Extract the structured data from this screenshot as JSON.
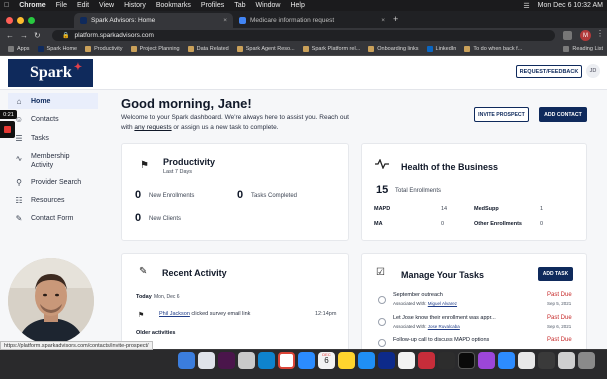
{
  "menubar": {
    "app": "Chrome",
    "items": [
      "File",
      "Edit",
      "View",
      "History",
      "Bookmarks",
      "Profiles",
      "Tab",
      "Window",
      "Help"
    ],
    "datetime": "Mon Dec 6  10:32 AM"
  },
  "tabs": [
    {
      "title": "Spark Advisors: Home",
      "active": true
    },
    {
      "title": "Medicare information request",
      "active": false
    }
  ],
  "address": {
    "url": "platform.sparkadvisors.com"
  },
  "bookmarks": [
    "Apps",
    "Spark Home",
    "Productivity",
    "Project Planning",
    "Data Related",
    "Spark Agent Reso...",
    "Spark Platform rel...",
    "Onboarding links",
    "LinkedIn",
    "To do when back f..."
  ],
  "reading_list": "Reading List",
  "recording": {
    "timer": "0:21"
  },
  "header": {
    "logo": "Spark",
    "request_feedback": "REQUEST/FEEDBACK",
    "avatar_initials": "JD"
  },
  "sidebar": {
    "items": [
      {
        "label": "Home",
        "icon": "home-icon"
      },
      {
        "label": "Contacts",
        "icon": "contacts-icon"
      },
      {
        "label": "Tasks",
        "icon": "tasks-icon"
      },
      {
        "label": "Membership Activity",
        "icon": "activity-icon"
      },
      {
        "label": "Provider Search",
        "icon": "search-icon"
      },
      {
        "label": "Resources",
        "icon": "resources-icon"
      },
      {
        "label": "Contact Form",
        "icon": "form-icon"
      }
    ]
  },
  "main": {
    "greeting": "Good morning, Jane!",
    "welcome_1": "Welcome to your Spark dashboard. We're always here to assist you. Reach out with ",
    "welcome_link": "any requests",
    "welcome_2": " or assign us a new task to complete.",
    "invite_button": "INVITE PROSPECT",
    "add_contact_button": "ADD CONTACT"
  },
  "productivity": {
    "title": "Productivity",
    "subtitle": "Last 7 Days",
    "stats": [
      {
        "value": "0",
        "label": "New Enrollments"
      },
      {
        "value": "0",
        "label": "Tasks Completed"
      },
      {
        "value": "0",
        "label": "New Clients"
      }
    ]
  },
  "health": {
    "title": "Health of the Business",
    "total_value": "15",
    "total_label": "Total Enrollments",
    "rows": [
      {
        "label": "MAPD",
        "value": "14"
      },
      {
        "label": "MedSupp",
        "value": "1"
      },
      {
        "label": "MA",
        "value": "0"
      },
      {
        "label": "Other Enrollments",
        "value": "0"
      }
    ]
  },
  "activity": {
    "title": "Recent Activity",
    "today_label": "Today",
    "today_date": "Mon, Dec 6",
    "entry_name": "Phil Jackson",
    "entry_text": " clicked survey email link",
    "entry_time": "12:14pm",
    "older": "Older activities"
  },
  "tasks": {
    "title": "Manage Your Tasks",
    "add_button": "ADD TASK",
    "items": [
      {
        "title": "September outreach",
        "assoc_label": "Associated With: ",
        "assoc_name": "Miguel Alvarez",
        "status": "Past Due",
        "date": "Sep 5, 2021"
      },
      {
        "title": "Let Jose know their enrollment was appr...",
        "assoc_label": "Associated With: ",
        "assoc_name": "Jose Ruvalcaba",
        "status": "Past Due",
        "date": "Sep 6, 2021"
      },
      {
        "title": "Follow-up call to discuss MAPD options",
        "assoc_label": "",
        "assoc_name": "",
        "status": "Past Due",
        "date": ""
      }
    ]
  },
  "status_url": "https://platform.sparkadvisors.com/contacts/invite-prospect/",
  "dock_calendar": {
    "month": "DEC",
    "day": "6"
  },
  "colors": {
    "brand": "#0f2a5c",
    "accent": "#e2404a",
    "past_due": "#c62828"
  }
}
